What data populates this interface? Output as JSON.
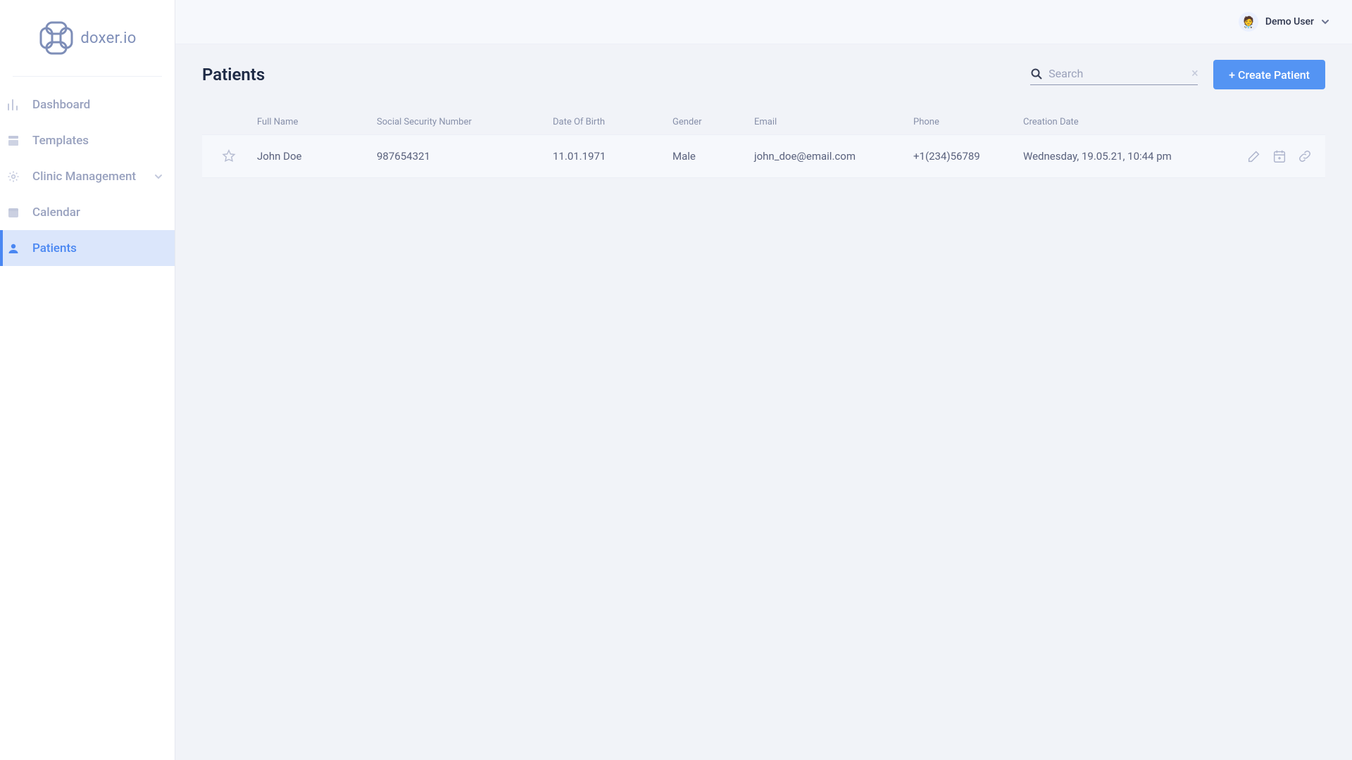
{
  "brand": {
    "name": "doxer.io"
  },
  "sidebar": {
    "items": [
      {
        "label": "Dashboard",
        "icon": "bar-chart-icon"
      },
      {
        "label": "Templates",
        "icon": "template-icon"
      },
      {
        "label": "Clinic Management",
        "icon": "gear-icon",
        "expandable": true
      },
      {
        "label": "Calendar",
        "icon": "calendar-icon"
      },
      {
        "label": "Patients",
        "icon": "person-icon",
        "active": true
      }
    ]
  },
  "topbar": {
    "user_name": "Demo User"
  },
  "page": {
    "title": "Patients",
    "search_placeholder": "Search",
    "create_button_label": "+ Create Patient"
  },
  "table": {
    "headers": {
      "full_name": "Full Name",
      "ssn": "Social Security Number",
      "dob": "Date Of Birth",
      "gender": "Gender",
      "email": "Email",
      "phone": "Phone",
      "creation_date": "Creation Date"
    },
    "rows": [
      {
        "full_name": "John Doe",
        "ssn": "987654321",
        "dob": "11.01.1971",
        "gender": "Male",
        "email": "john_doe@email.com",
        "phone": "+1(234)56789",
        "creation_date": "Wednesday, 19.05.21, 10:44 pm"
      }
    ]
  }
}
